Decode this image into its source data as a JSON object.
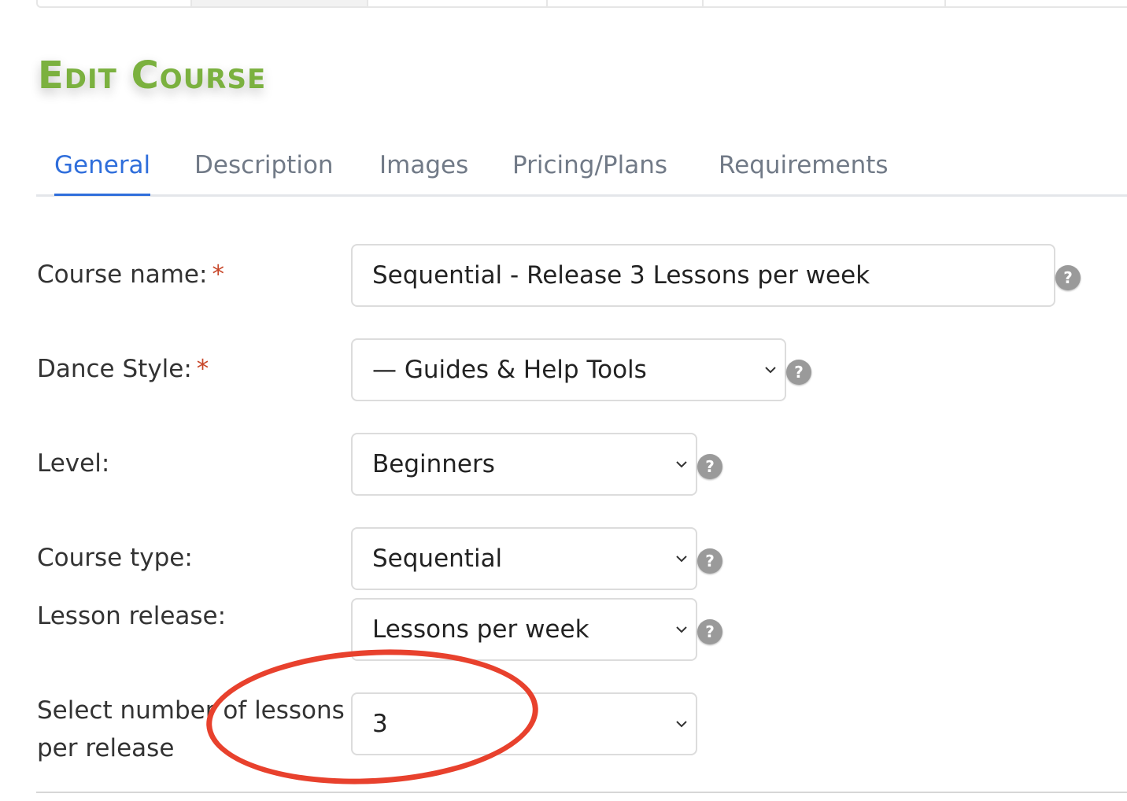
{
  "page_title": "Edit Course",
  "tabs": [
    {
      "label": "General"
    },
    {
      "label": "Description"
    },
    {
      "label": "Images"
    },
    {
      "label": "Pricing/Plans"
    },
    {
      "label": "Requirements"
    }
  ],
  "required_mark": "*",
  "help_glyph": "?",
  "fields": {
    "course_name": {
      "label": "Course name:",
      "value": "Sequential - Release 3 Lessons per week"
    },
    "dance_style": {
      "label": "Dance Style:",
      "value": "— Guides & Help Tools"
    },
    "level": {
      "label": "Level:",
      "value": "Beginners"
    },
    "course_type": {
      "label": "Course type:",
      "value": "Sequential"
    },
    "lesson_release": {
      "label": "Lesson release:",
      "value": "Lessons per week"
    },
    "lessons_per_release": {
      "label_line1": "Select number of lessons",
      "label_line2": "per release",
      "value": "3"
    }
  },
  "colors": {
    "title": "#7bb13f",
    "active_tab": "#2f6edb",
    "required": "#c8472a",
    "annotation_circle": "#e8412d"
  }
}
